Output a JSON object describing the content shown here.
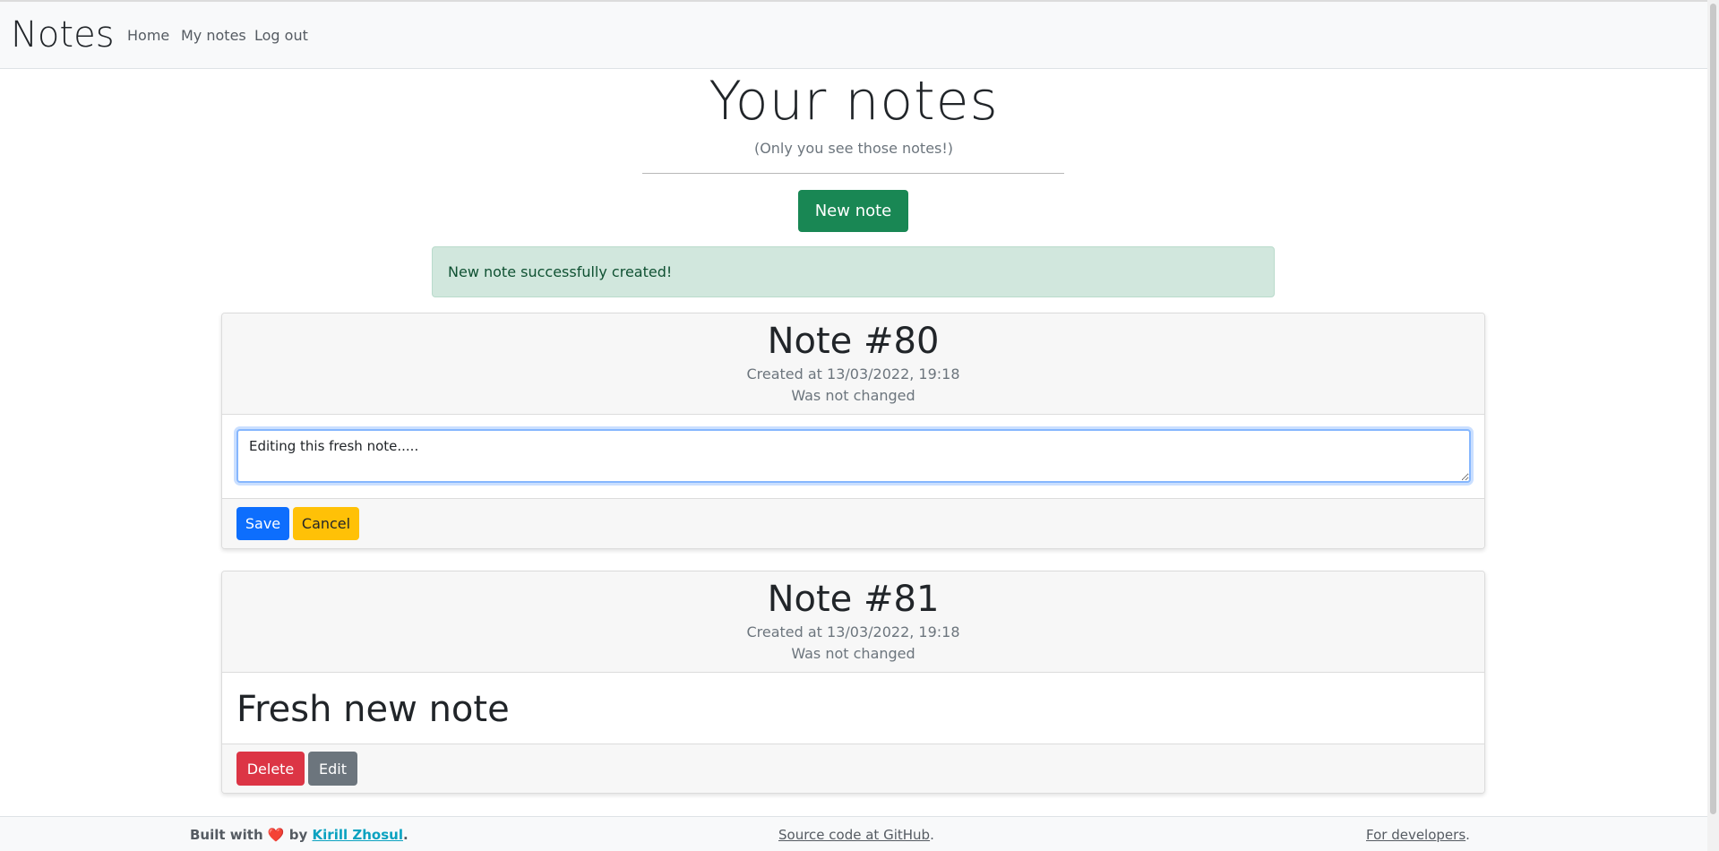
{
  "nav": {
    "brand": "Notes",
    "links": [
      "Home",
      "My notes",
      "Log out"
    ]
  },
  "hero": {
    "title": "Your notes",
    "subtitle": "(Only you see those notes!)",
    "new_note_label": "New note"
  },
  "alert": {
    "message": "New note successfully created!"
  },
  "notes": [
    {
      "title": "Note #80",
      "created": "Created at 13/03/2022, 19:18",
      "changed": "Was not changed",
      "editing": true,
      "edit_value": "Editing this fresh note.....",
      "save_label": "Save",
      "cancel_label": "Cancel"
    },
    {
      "title": "Note #81",
      "created": "Created at 13/03/2022, 19:18",
      "changed": "Was not changed",
      "editing": false,
      "text": "Fresh new note",
      "delete_label": "Delete",
      "edit_label": "Edit"
    }
  ],
  "footer": {
    "built_with": "Built with",
    "heart": "❤️",
    "by": "by",
    "author": "Kirill Zhosul",
    "source_link": "Source code at GitHub",
    "dev_link": "For developers",
    "period": "."
  },
  "colors": {
    "primary": "#0d6efd",
    "success": "#198754",
    "warning": "#ffc107",
    "danger": "#dc3545",
    "secondary": "#6c757d",
    "alert_bg": "#d1e7dd",
    "link_accent": "#0aa2c0"
  }
}
